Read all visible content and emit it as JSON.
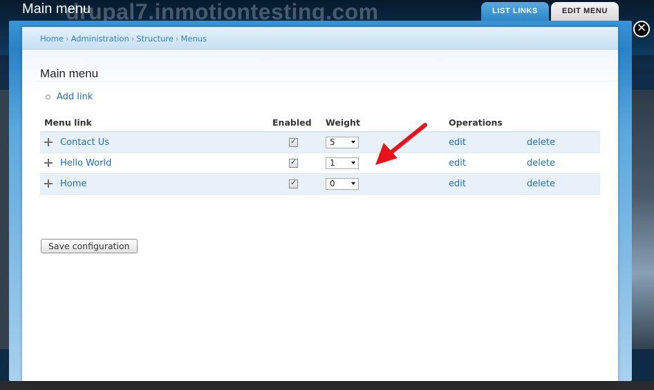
{
  "background": {
    "site_name": "drupal7.inmotiontesting.com"
  },
  "overlay": {
    "title": "Main menu",
    "tabs": [
      {
        "label": "LIST LINKS",
        "active": true
      },
      {
        "label": "EDIT MENU",
        "active": false
      }
    ],
    "close_icon": "close-icon"
  },
  "breadcrumb": [
    {
      "label": "Home"
    },
    {
      "label": "Administration"
    },
    {
      "label": "Structure"
    },
    {
      "label": "Menus"
    }
  ],
  "page": {
    "title": "Main menu",
    "add_link_label": "Add link"
  },
  "table": {
    "headers": {
      "menu_link": "Menu link",
      "enabled": "Enabled",
      "weight": "Weight",
      "operations": "Operations"
    },
    "rows": [
      {
        "title": "Contact Us",
        "enabled": true,
        "weight": "5",
        "edit": "edit",
        "delete": "delete"
      },
      {
        "title": "Hello World",
        "enabled": true,
        "weight": "1",
        "edit": "edit",
        "delete": "delete"
      },
      {
        "title": "Home",
        "enabled": true,
        "weight": "0",
        "edit": "edit",
        "delete": "delete"
      }
    ]
  },
  "actions": {
    "save_label": "Save configuration"
  },
  "colors": {
    "accent_blue": "#2d87c8",
    "link_blue": "#1f6fb0",
    "annotation_arrow": "#e8131a"
  }
}
